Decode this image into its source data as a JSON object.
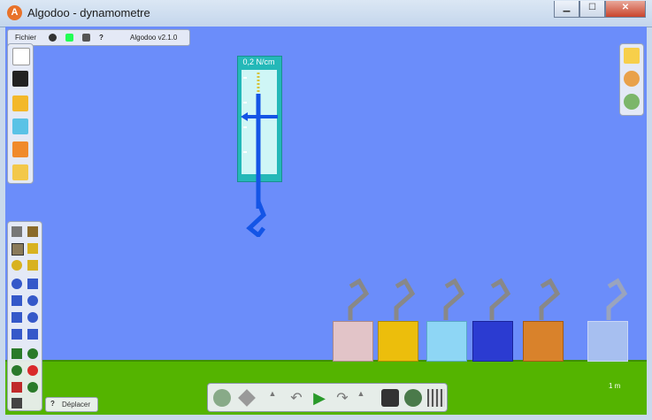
{
  "window": {
    "title": "Algodoo - dynamometre"
  },
  "menu": {
    "file_label": "Fichier",
    "help_label": "?",
    "version": "Algodoo v2.1.0"
  },
  "dynamometer": {
    "reading": "0,2 N/cm"
  },
  "hint": {
    "icon": "?",
    "label": "Déplacer"
  },
  "scale": {
    "label": "1 m"
  },
  "colors": {
    "sky": "#6b8dfa",
    "ground": "#54b400",
    "dynamometer": "#24b8b8"
  },
  "blocks": [
    {
      "name": "pink-stone",
      "color": "#e2c4c8"
    },
    {
      "name": "gold",
      "color": "#ecbe0c"
    },
    {
      "name": "light-blue",
      "color": "#8ed6f5"
    },
    {
      "name": "navy",
      "color": "#2b3bd1"
    },
    {
      "name": "wood",
      "color": "#d9822b"
    },
    {
      "name": "transparent",
      "color": "#a7bff0"
    }
  ]
}
